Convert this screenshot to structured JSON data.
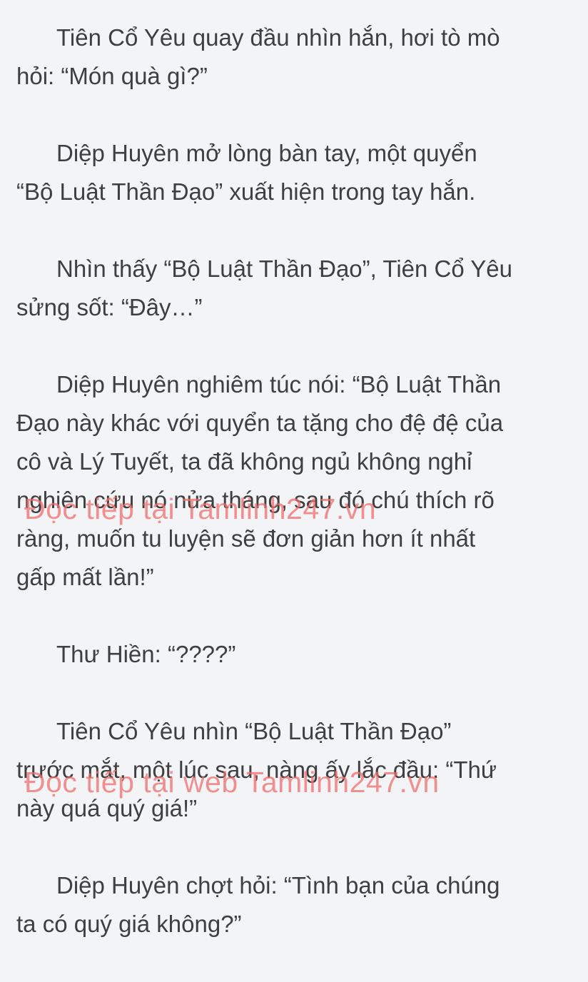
{
  "paragraphs": [
    {
      "lines": [
        "Tiên Cổ Yêu quay đầu nhìn hắn, hơi tò mò",
        "hỏi: “Món quà gì?”"
      ]
    },
    {
      "lines": [
        "Diệp Huyên mở lòng bàn tay, một quyển",
        "“Bộ Luật Thần Đạo” xuất hiện trong tay hắn."
      ]
    },
    {
      "lines": [
        "Nhìn thấy “Bộ Luật Thần Đạo”, Tiên Cổ Yêu",
        "sửng sốt: “Đây…”"
      ]
    },
    {
      "lines": [
        "Diệp Huyên nghiêm túc nói: “Bộ Luật Thần",
        "Đạo này khác với quyển ta tặng cho đệ đệ của",
        "cô và Lý Tuyết, ta đã không ngủ không nghỉ",
        "nghiên cứu nó nửa tháng, sau đó chú thích rõ",
        "ràng, muốn tu luyện sẽ đơn giản hơn ít nhất",
        "gấp mất lần!”"
      ]
    },
    {
      "lines": [
        "Thư Hiền: “????”"
      ]
    },
    {
      "lines": [
        "Tiên Cổ Yêu nhìn “Bộ Luật Thần Đạo”",
        "trước mắt, một lúc sau, nàng ấy lắc đầu: “Thứ",
        "này quá quý giá!”"
      ]
    },
    {
      "lines": [
        "Diệp Huyên chợt hỏi: “Tình bạn của chúng",
        "ta có quý giá không?”"
      ]
    }
  ],
  "watermarks": [
    "Đọc tiếp tại Tamlinh247.vn",
    "Đọc tiếp tại web Tamlinh247.vn"
  ],
  "colors": {
    "background": "#f3f4f6",
    "text": "#3f3f3f",
    "watermark": "#f06e6e"
  }
}
